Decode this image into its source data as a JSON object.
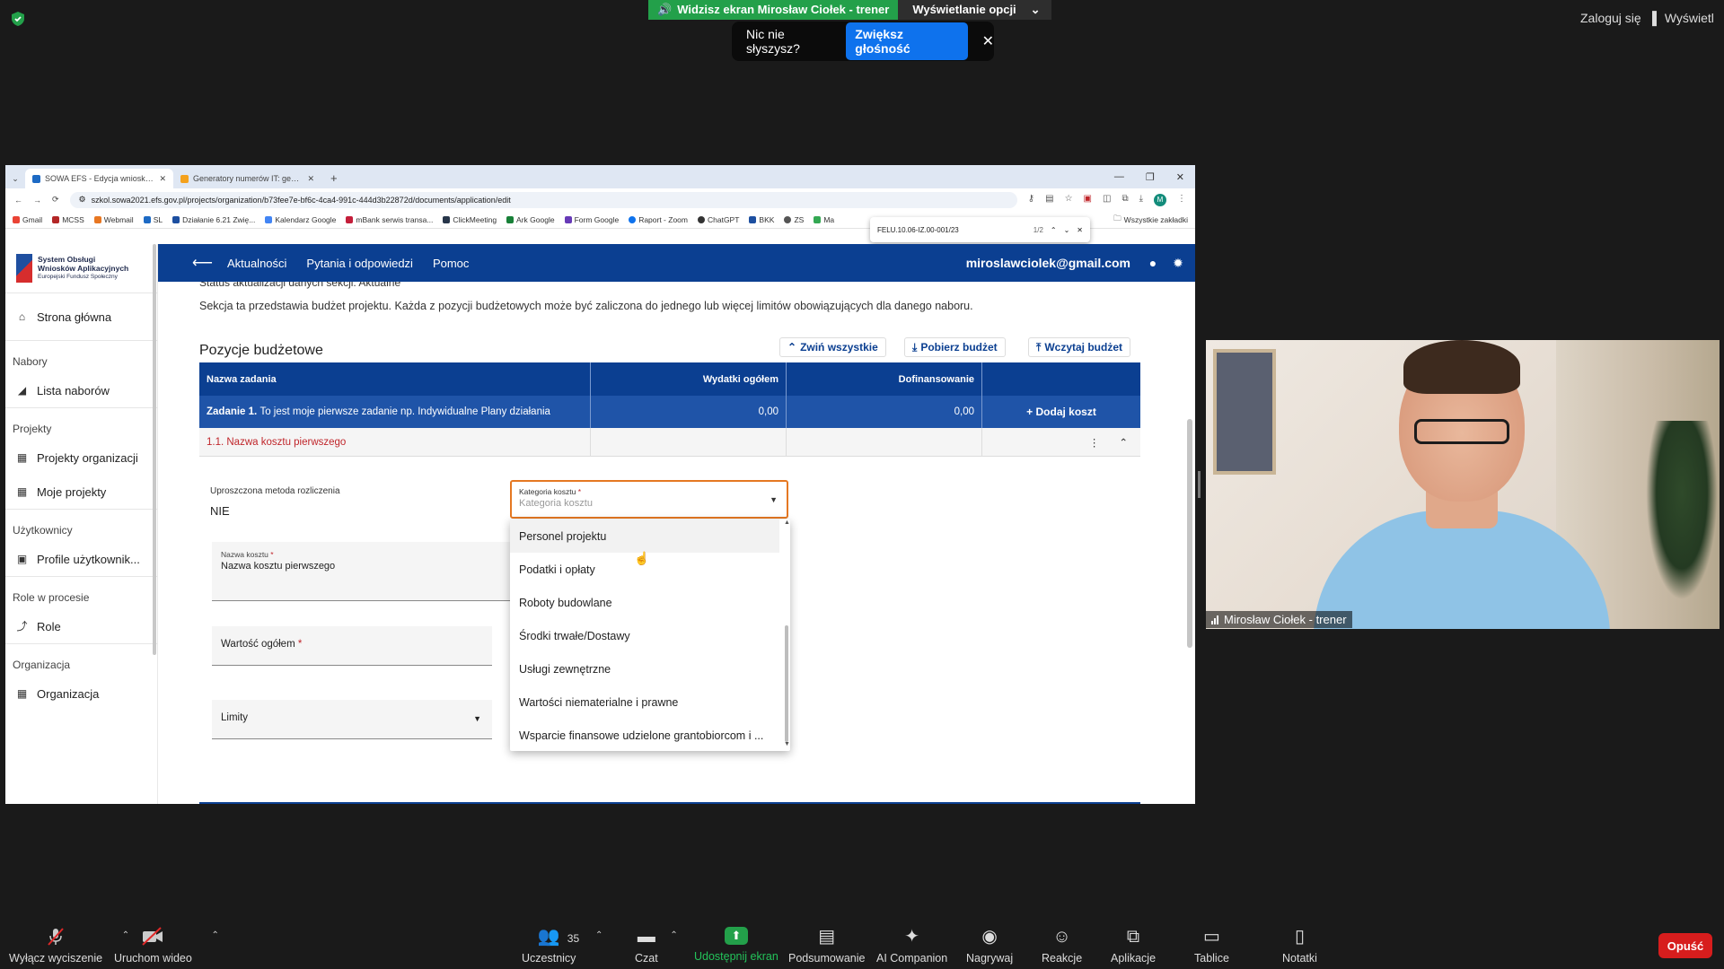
{
  "zoom": {
    "share_banner": "Widzisz ekran Mirosław Ciołek - trener",
    "view_options": "Wyświetlanie opcji",
    "audio_tip": "Nic nie słyszysz?",
    "audio_button": "Zwiększ głośność",
    "login": "Zaloguj się",
    "view": "Wyświetl",
    "participant_label": "Mirosław Ciołek - trener",
    "toolbar": {
      "mute": "Wyłącz wyciszenie",
      "video": "Uruchom wideo",
      "participants": "Uczestnicy",
      "participants_count": "35",
      "chat": "Czat",
      "share": "Udostępnij ekran",
      "summary": "Podsumowanie",
      "companion": "AI Companion",
      "record": "Nagrywaj",
      "reactions": "Reakcje",
      "apps": "Aplikacje",
      "whiteboards": "Tablice",
      "notes": "Notatki",
      "leave": "Opuść"
    }
  },
  "browser": {
    "tabs": [
      {
        "title": "SOWA EFS - Edycja wniosku o ..."
      },
      {
        "title": "Generatory numerów IT: gener..."
      }
    ],
    "url": "szkol.sowa2021.efs.gov.pl/projects/organization/b73fee7e-bf6c-4ca4-991c-444d3b22872d/documents/application/edit",
    "bookmarks": [
      "Gmail",
      "MCSS",
      "Webmail",
      "SL",
      "Działanie 6.21 Zwię...",
      "Kalendarz Google",
      "mBank serwis transa...",
      "ClickMeeting",
      "Ark Google",
      "Form Google",
      "Raport - Zoom",
      "ChatGPT",
      "BKK",
      "ZS",
      "Ma"
    ],
    "bookmarks_all": "Wszystkie zakładki",
    "find": {
      "query": "FELU.10.06-IZ.00-001/23",
      "count": "1/2"
    }
  },
  "app": {
    "logo_line1": "System Obsługi",
    "logo_line2": "Wniosków Aplikacyjnych",
    "logo_sub": "Europejski Fundusz Społeczny",
    "sidebar": {
      "home": "Strona główna",
      "h_nabory": "Nabory",
      "lista_naborow": "Lista naborów",
      "h_projekty": "Projekty",
      "projekty_org": "Projekty organizacji",
      "moje_projekty": "Moje projekty",
      "h_uzytkownicy": "Użytkownicy",
      "profile": "Profile użytkownik...",
      "h_role": "Role w procesie",
      "role": "Role",
      "h_org": "Organizacja",
      "organizacja": "Organizacja"
    },
    "nav": {
      "aktualnosci": "Aktualności",
      "pytania": "Pytania i odpowiedzi",
      "pomoc": "Pomoc",
      "email": "miroslawciolek@gmail.com"
    },
    "status_text": "Status aktualizacji danych sekcji: Aktualne",
    "description": "Sekcja ta przedstawia budżet projektu. Każda z pozycji budżetowych może być zaliczona do jednego lub więcej limitów obowiązujących dla danego naboru.",
    "budget_title": "Pozycje budżetowe",
    "btn_collapse": "Zwiń wszystkie",
    "btn_download": "Pobierz budżet",
    "btn_upload": "Wczytaj budżet",
    "table": {
      "headers": [
        "Nazwa zadania",
        "Wydatki ogółem",
        "Dofinansowanie",
        ""
      ],
      "task_prefix": "Zadanie 1.",
      "task_name": "To jest moje pierwsze zadanie np. Indywidualne Plany działania",
      "task_wydatki": "0,00",
      "task_dofin": "0,00",
      "add_cost": "+ Dodaj koszt",
      "cost_name": "1.1. Nazwa kosztu pierwszego"
    },
    "form": {
      "uproszczona_label": "Uproszczona metoda rozliczenia",
      "uproszczona_val": "NIE",
      "kategoria_label": "Kategoria kosztu",
      "kategoria_placeholder": "Kategoria kosztu",
      "nazwa_label": "Nazwa kosztu",
      "nazwa_val": "Nazwa kosztu pierwszego",
      "wartosc_label": "Wartość ogółem",
      "limity_label": "Limity"
    },
    "dropdown_options": [
      "Personel projektu",
      "Podatki i opłaty",
      "Roboty budowlane",
      "Środki trwałe/Dostawy",
      "Usługi zewnętrzne",
      "Wartości niematerialne i prawne",
      "Wsparcie finansowe udzielone grantobiorcom i ..."
    ]
  }
}
